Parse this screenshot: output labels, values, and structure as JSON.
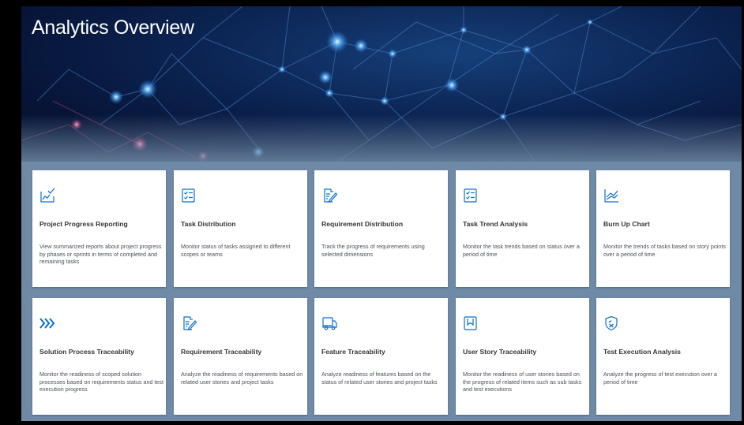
{
  "page": {
    "title": "Analytics Overview"
  },
  "theme": {
    "accent": "#0a6ed1",
    "tile_bg": "#ffffff",
    "section_bg": "#6f8aa7",
    "hero_bg": "#0c2554"
  },
  "tiles": [
    {
      "title": "Project Progress Reporting",
      "description": "View summarized reports about project progress by phases or sprints in terms of completed and remaining tasks",
      "icon": "progress-report-icon"
    },
    {
      "title": "Task Distribution",
      "description": "Monitor status of tasks assigned to different scopes or teams",
      "icon": "checklist-icon"
    },
    {
      "title": "Requirement Distribution",
      "description": "Track the progress of requirements using selected dimensions",
      "icon": "document-edit-icon"
    },
    {
      "title": "Task Trend Analysis",
      "description": "Monitor the task trends based on status over a period of time",
      "icon": "checklist-icon"
    },
    {
      "title": "Burn Up Chart",
      "description": "Monitor the trends of tasks based on story points over a period of time",
      "icon": "line-chart-icon"
    },
    {
      "title": "Solution Process Traceability",
      "description": "Monitor the readiness of scoped solution processes based on requirements status and test execution progress",
      "icon": "process-chevrons-icon"
    },
    {
      "title": "Requirement Traceability",
      "description": "Analyze the readiness of requirements based on related user stories and project tasks",
      "icon": "document-edit-icon"
    },
    {
      "title": "Feature Traceability",
      "description": "Analyze readiness of features based on the status of related user stories and project tasks",
      "icon": "shipping-truck-icon"
    },
    {
      "title": "User Story Traceability",
      "description": "Monitor the readiness of user stories based on the progress of related items such as sub tasks and test executions",
      "icon": "bookmark-icon"
    },
    {
      "title": "Test Execution Analysis",
      "description": "Analyze the progress of test execution over a period of time",
      "icon": "test-shield-icon"
    }
  ]
}
